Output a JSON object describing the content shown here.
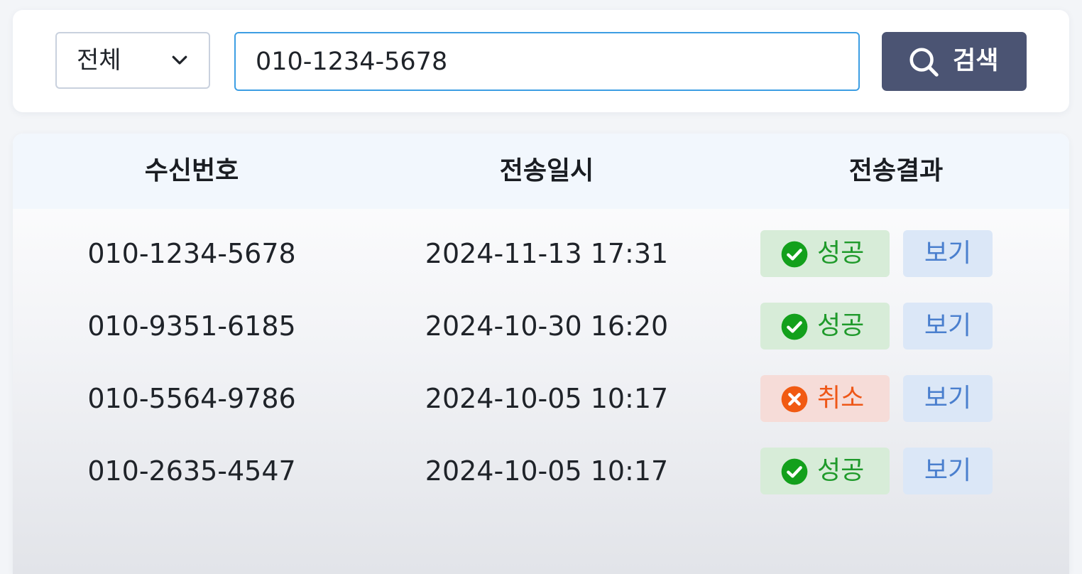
{
  "colors": {
    "search_button_bg": "#4b5473",
    "input_border": "#3d9ee3",
    "success": "#1f9a2b",
    "cancel": "#ee5718",
    "view_button_text": "#4a7fce",
    "header_bg": "#f2f7fd"
  },
  "search": {
    "filter": {
      "selected": "전체",
      "icon": "chevron-down-icon"
    },
    "input_value": "010-1234-5678",
    "button_label": "검색",
    "button_icon": "search-icon"
  },
  "table": {
    "headers": {
      "phone": "수신번호",
      "sent_at": "전송일시",
      "result": "전송결과"
    },
    "rows": [
      {
        "phone": "010-1234-5678",
        "sent_at": "2024-11-13 17:31",
        "status": "성공",
        "status_type": "success",
        "status_icon": "check-circle-icon",
        "action": "보기"
      },
      {
        "phone": "010-9351-6185",
        "sent_at": "2024-10-30 16:20",
        "status": "성공",
        "status_type": "success",
        "status_icon": "check-circle-icon",
        "action": "보기"
      },
      {
        "phone": "010-5564-9786",
        "sent_at": "2024-10-05 10:17",
        "status": "취소",
        "status_type": "cancel",
        "status_icon": "x-circle-icon",
        "action": "보기"
      },
      {
        "phone": "010-2635-4547",
        "sent_at": "2024-10-05 10:17",
        "status": "성공",
        "status_type": "success",
        "status_icon": "check-circle-icon",
        "action": "보기"
      }
    ]
  }
}
